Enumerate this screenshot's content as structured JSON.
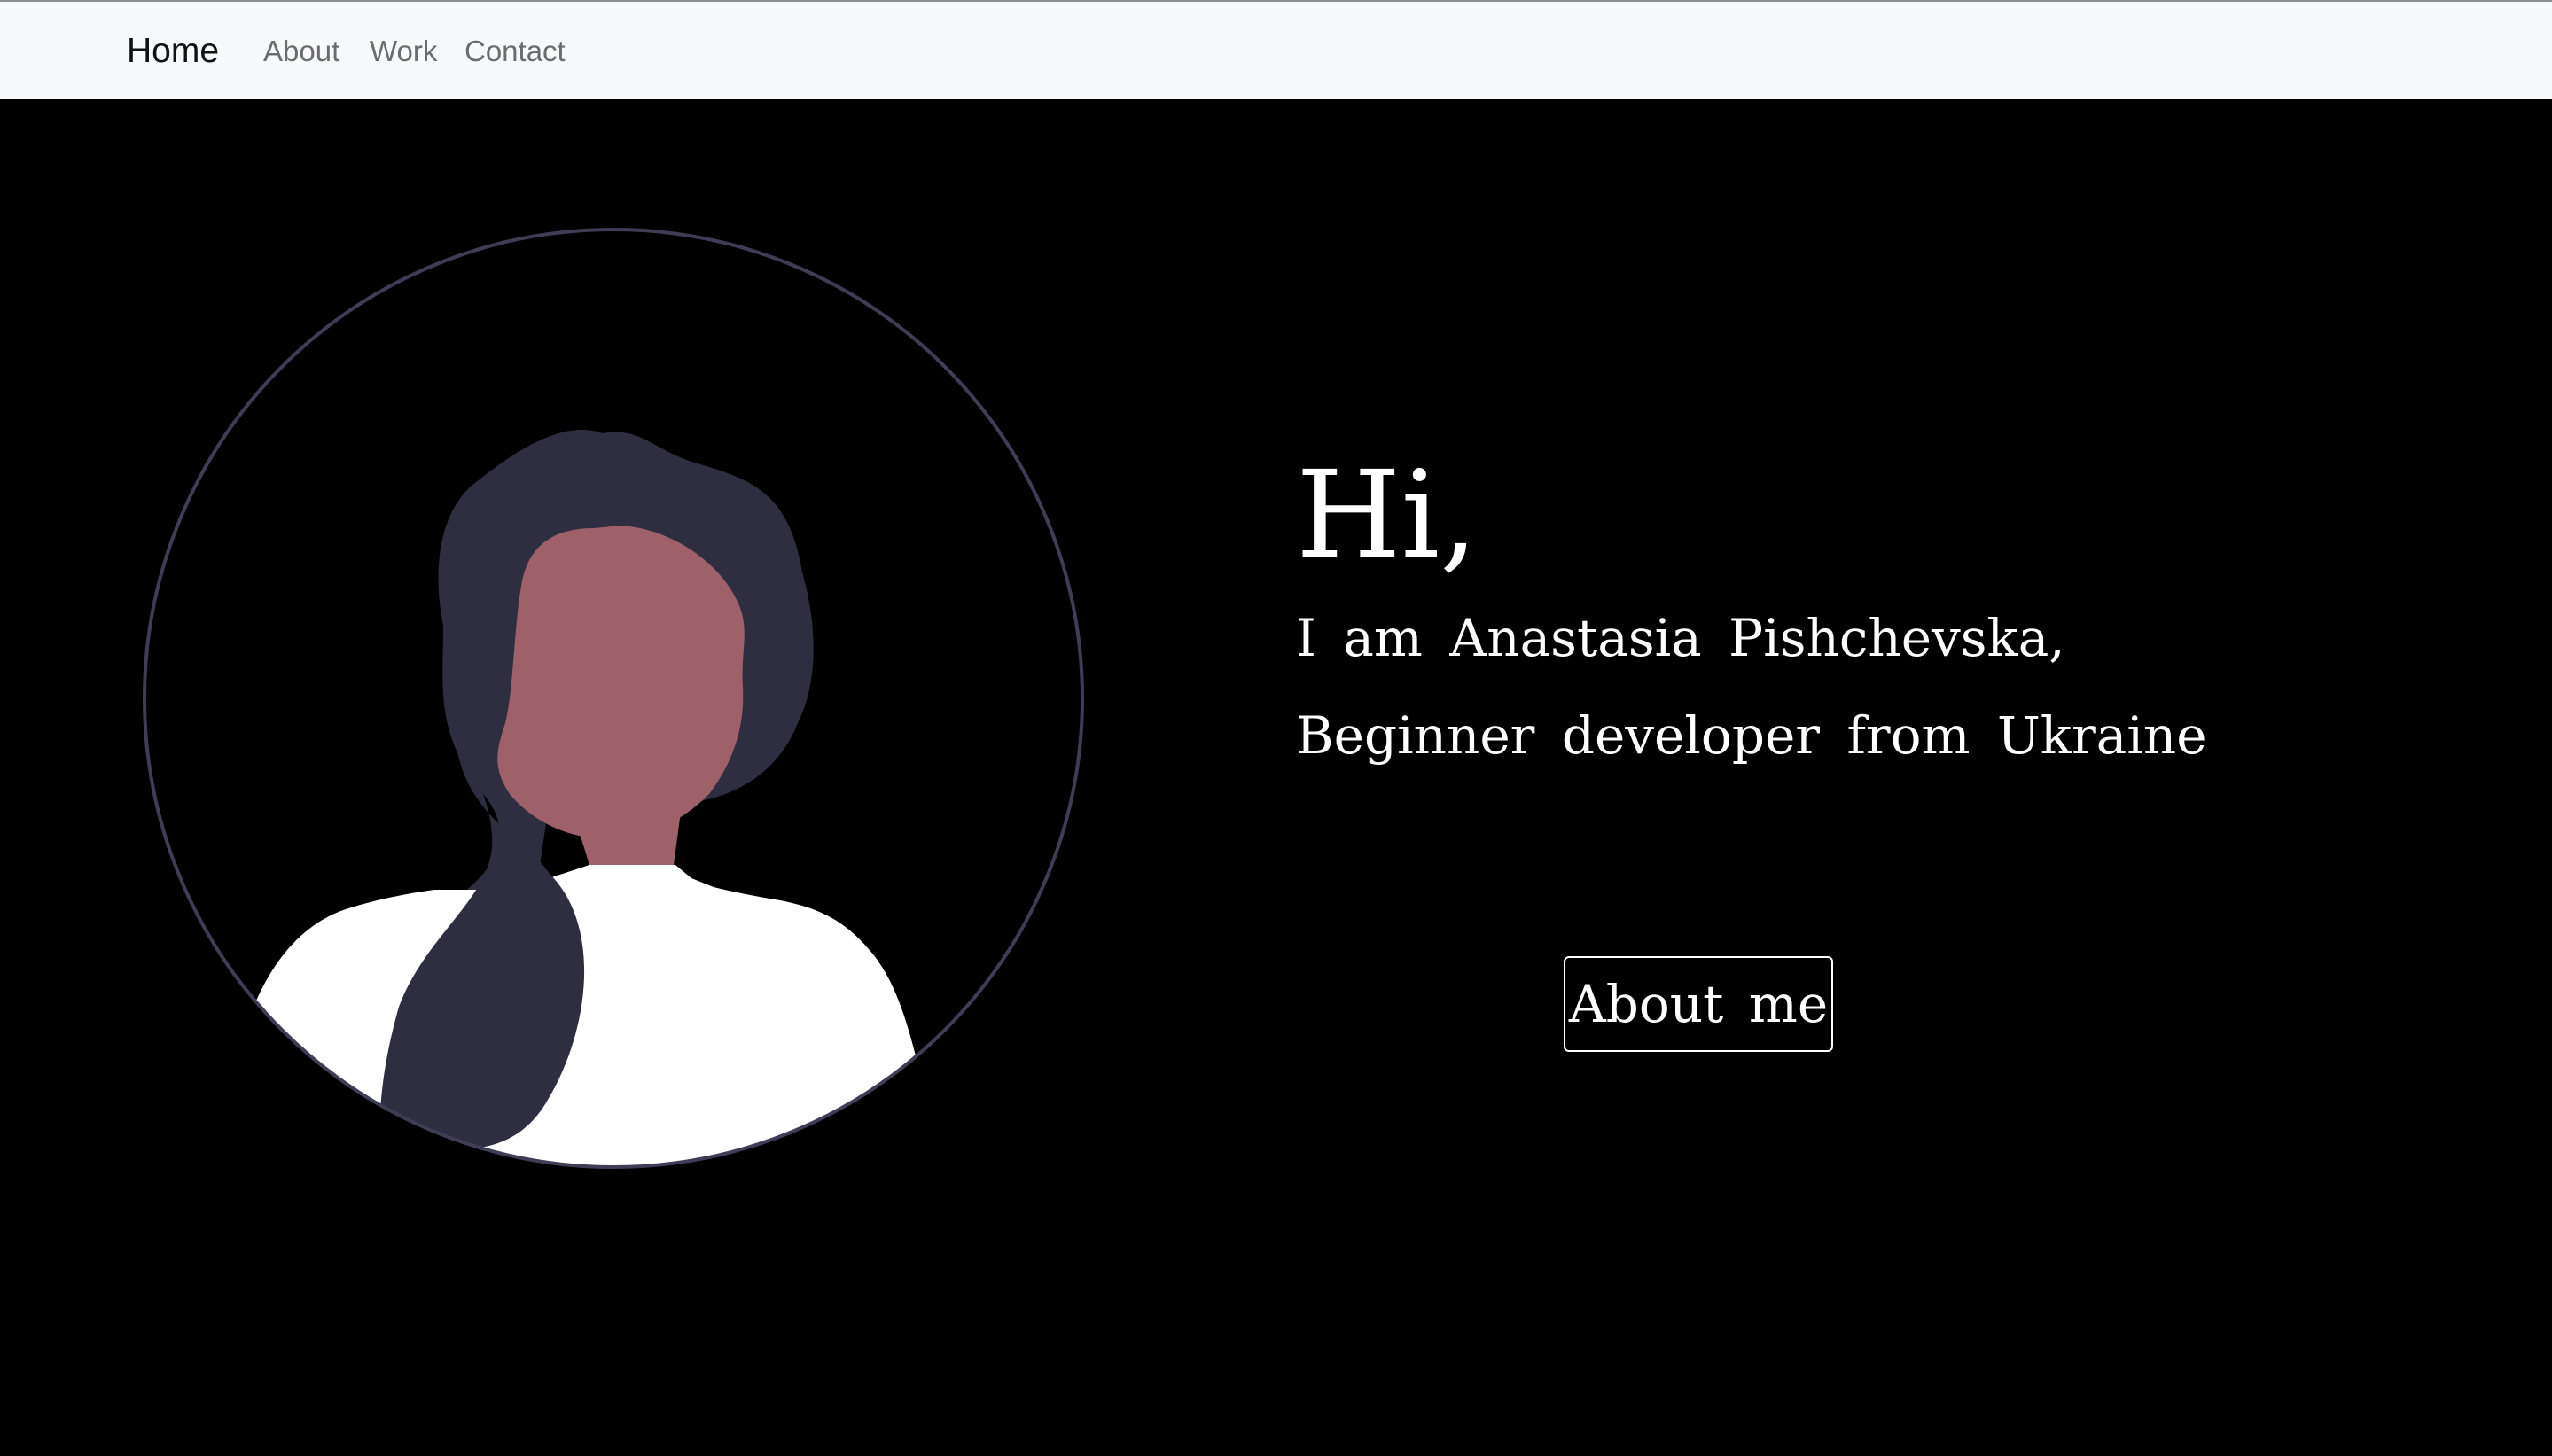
{
  "navbar": {
    "brand": "Home",
    "links": [
      {
        "label": "About"
      },
      {
        "label": "Work"
      },
      {
        "label": "Contact"
      }
    ]
  },
  "hero": {
    "greeting": "Hi,",
    "intro_line_1": "I am Anastasia Pishchevska,",
    "intro_line_2": "Beginner developer from Ukraine",
    "cta_label": "About me"
  },
  "colors": {
    "navbar_bg": "#f8f9fa",
    "page_bg": "#000000",
    "circle_stroke": "#3f3d56",
    "hair": "#2f2e41",
    "skin": "#9e616a",
    "shirt": "#ffffff",
    "text": "#ffffff"
  },
  "icons": {
    "avatar": "woman-avatar-illustration"
  }
}
